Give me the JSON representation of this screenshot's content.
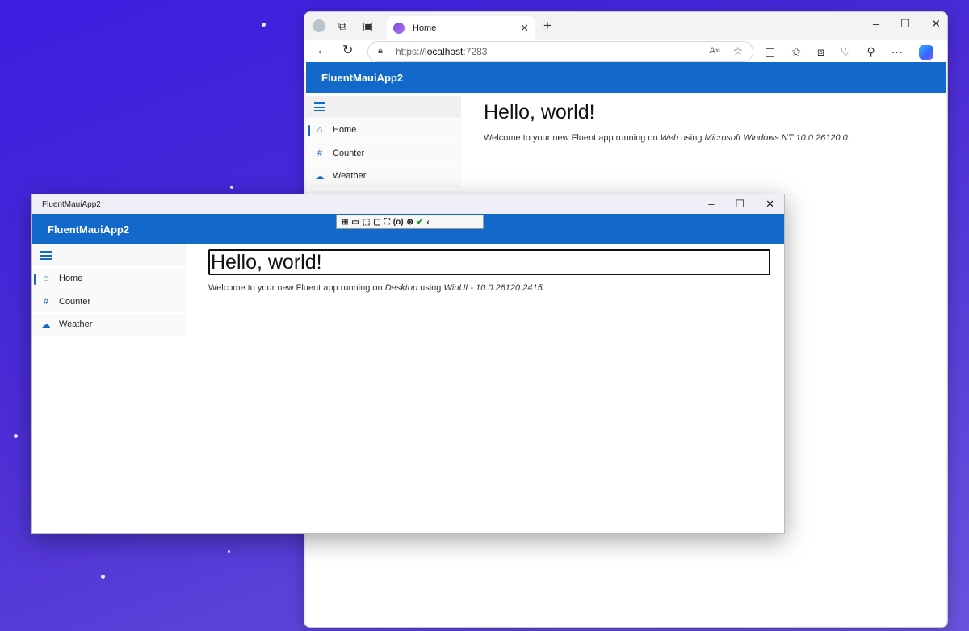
{
  "browser": {
    "tab_title": "Home",
    "url_scheme": "https://",
    "url_host": "localhost",
    "url_port": ":7283",
    "app_title": "FluentMauiApp2",
    "heading": "Hello, world!",
    "welcome_prefix": "Welcome to your new Fluent app running on ",
    "platform": "Web",
    "using_word": " using ",
    "os": "Microsoft Windows NT 10.0.26120.0",
    "period": ".",
    "nav": [
      {
        "label": "Home",
        "icon": "home-icon"
      },
      {
        "label": "Counter",
        "icon": "number-symbol-icon"
      },
      {
        "label": "Weather",
        "icon": "weather-partly-cloudy-icon"
      }
    ]
  },
  "maui": {
    "window_title": "FluentMauiApp2",
    "app_title": "FluentMauiApp2",
    "heading": "Hello, world!",
    "welcome_prefix": "Welcome to your new Fluent app running on ",
    "platform": "Desktop",
    "using_word": " using ",
    "os": "WinUI - 10.0.26120.2415",
    "period": ".",
    "nav": [
      {
        "label": "Home",
        "icon": "home-icon"
      },
      {
        "label": "Counter",
        "icon": "number-symbol-icon"
      },
      {
        "label": "Weather",
        "icon": "weather-partly-cloudy-icon"
      }
    ]
  },
  "colors": {
    "accent": "#1369c9",
    "desktop_background": "#3b1ee0"
  }
}
